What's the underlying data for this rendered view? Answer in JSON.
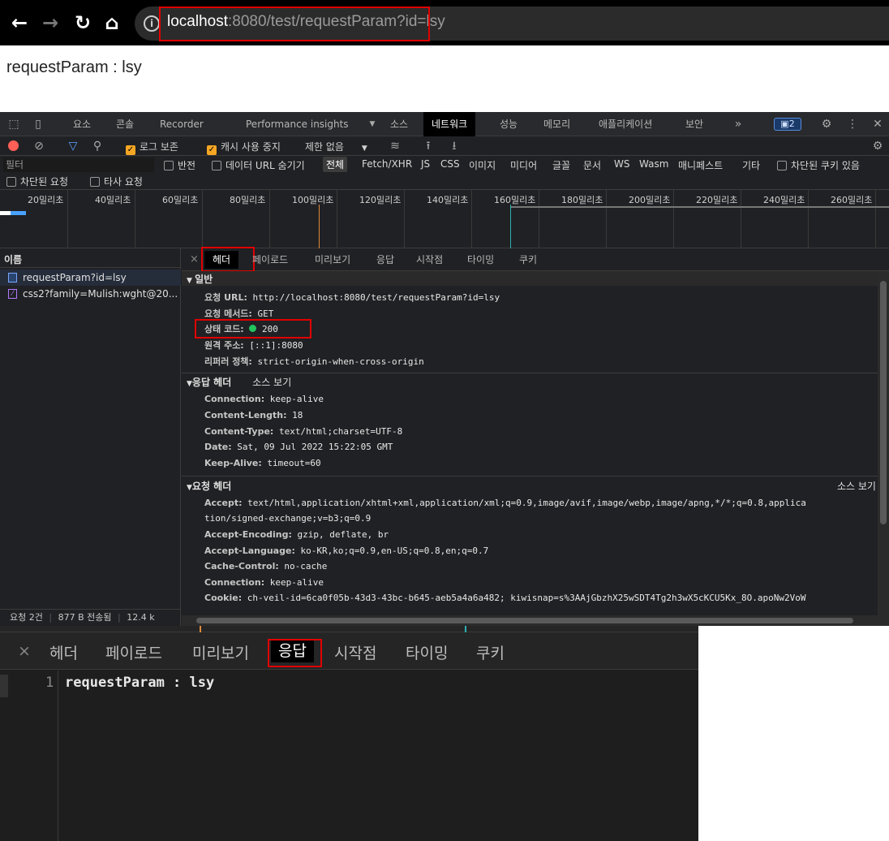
{
  "browser": {
    "url_host": "localhost",
    "url_rest": ":8080/test/requestParam?id=lsy",
    "info_icon": "info-icon"
  },
  "page": {
    "body_text": "requestParam : lsy"
  },
  "devtools": {
    "main_tabs": [
      "요소",
      "콘솔",
      "Recorder",
      "Performance insights",
      "소스",
      "네트워크",
      "성능",
      "메모리",
      "애플리케이션",
      "보안"
    ],
    "selected_main_tab": "네트워크",
    "issues_badge": "2",
    "toolbar": {
      "preserve_log": "로그 보존",
      "disable_cache": "캐시 사용 중지",
      "throttle": "제한 없음"
    },
    "filter": {
      "placeholder": "필터",
      "invert": "반전",
      "hide_data_urls": "데이터 URL 숨기기",
      "all": "전체",
      "types": [
        "Fetch/XHR",
        "JS",
        "CSS",
        "이미지",
        "미디어",
        "글꼴",
        "문서",
        "WS",
        "Wasm",
        "매니페스트",
        "기타"
      ],
      "blocked_cookies": "차단된 쿠키 있음",
      "blocked_requests": "차단된 요청",
      "third_party": "타사 요청"
    },
    "timeline_labels": [
      "20밀리초",
      "40밀리초",
      "60밀리초",
      "80밀리초",
      "100밀리초",
      "120밀리초",
      "140밀리초",
      "160밀리초",
      "180밀리초",
      "200밀리초",
      "220밀리초",
      "240밀리초",
      "260밀리초"
    ],
    "request_list": {
      "header": "이름",
      "items": [
        "requestParam?id=lsy",
        "css2?family=Mulish:wght@20..."
      ],
      "status": [
        "요청 2건",
        "877 B 전송됨",
        "12.4 k"
      ]
    },
    "detail_tabs": [
      "헤더",
      "페이로드",
      "미리보기",
      "응답",
      "시작점",
      "타이밍",
      "쿠키"
    ],
    "selected_detail_tab": "헤더",
    "general": {
      "title": "일반",
      "rows": [
        {
          "k": "요청 URL:",
          "v": "http://localhost:8080/test/requestParam?id=lsy"
        },
        {
          "k": "요청 메서드:",
          "v": "GET"
        },
        {
          "k": "상태 코드:",
          "v": "200"
        },
        {
          "k": "원격 주소:",
          "v": "[::1]:8080"
        },
        {
          "k": "리퍼러 정책:",
          "v": "strict-origin-when-cross-origin"
        }
      ]
    },
    "response_headers": {
      "title": "응답 헤더",
      "view_source": "소스 보기",
      "rows": [
        {
          "k": "Connection:",
          "v": "keep-alive"
        },
        {
          "k": "Content-Length:",
          "v": "18"
        },
        {
          "k": "Content-Type:",
          "v": "text/html;charset=UTF-8"
        },
        {
          "k": "Date:",
          "v": "Sat, 09 Jul 2022 15:22:05 GMT"
        },
        {
          "k": "Keep-Alive:",
          "v": "timeout=60"
        }
      ]
    },
    "request_headers": {
      "title": "요청 헤더",
      "view_source": "소스 보기",
      "rows": [
        {
          "k": "Accept:",
          "v": "text/html,application/xhtml+xml,application/xml;q=0.9,image/avif,image/webp,image/apng,*/*;q=0.8,applica"
        },
        {
          "k": "",
          "v": "tion/signed-exchange;v=b3;q=0.9"
        },
        {
          "k": "Accept-Encoding:",
          "v": "gzip, deflate, br"
        },
        {
          "k": "Accept-Language:",
          "v": "ko-KR,ko;q=0.9,en-US;q=0.8,en;q=0.7"
        },
        {
          "k": "Cache-Control:",
          "v": "no-cache"
        },
        {
          "k": "Connection:",
          "v": "keep-alive"
        },
        {
          "k": "Cookie:",
          "v": "ch-veil-id=6ca0f05b-43d3-43bc-b645-aeb5a4a6a482; kiwisnap=s%3AAjGbzhX25wSDT4Tg2h3wX5cKCU5Kx_8O.apoNw2VoW"
        }
      ]
    }
  },
  "response_panel": {
    "tabs": [
      "헤더",
      "페이로드",
      "미리보기",
      "응답",
      "시작점",
      "타이밍",
      "쿠키"
    ],
    "selected": "응답",
    "line_number": "1",
    "content": "requestParam : lsy"
  },
  "colors": {
    "highlight_border": "#e00000",
    "accent_checkbox": "#f5a623",
    "status_ok": "#22c55e"
  }
}
